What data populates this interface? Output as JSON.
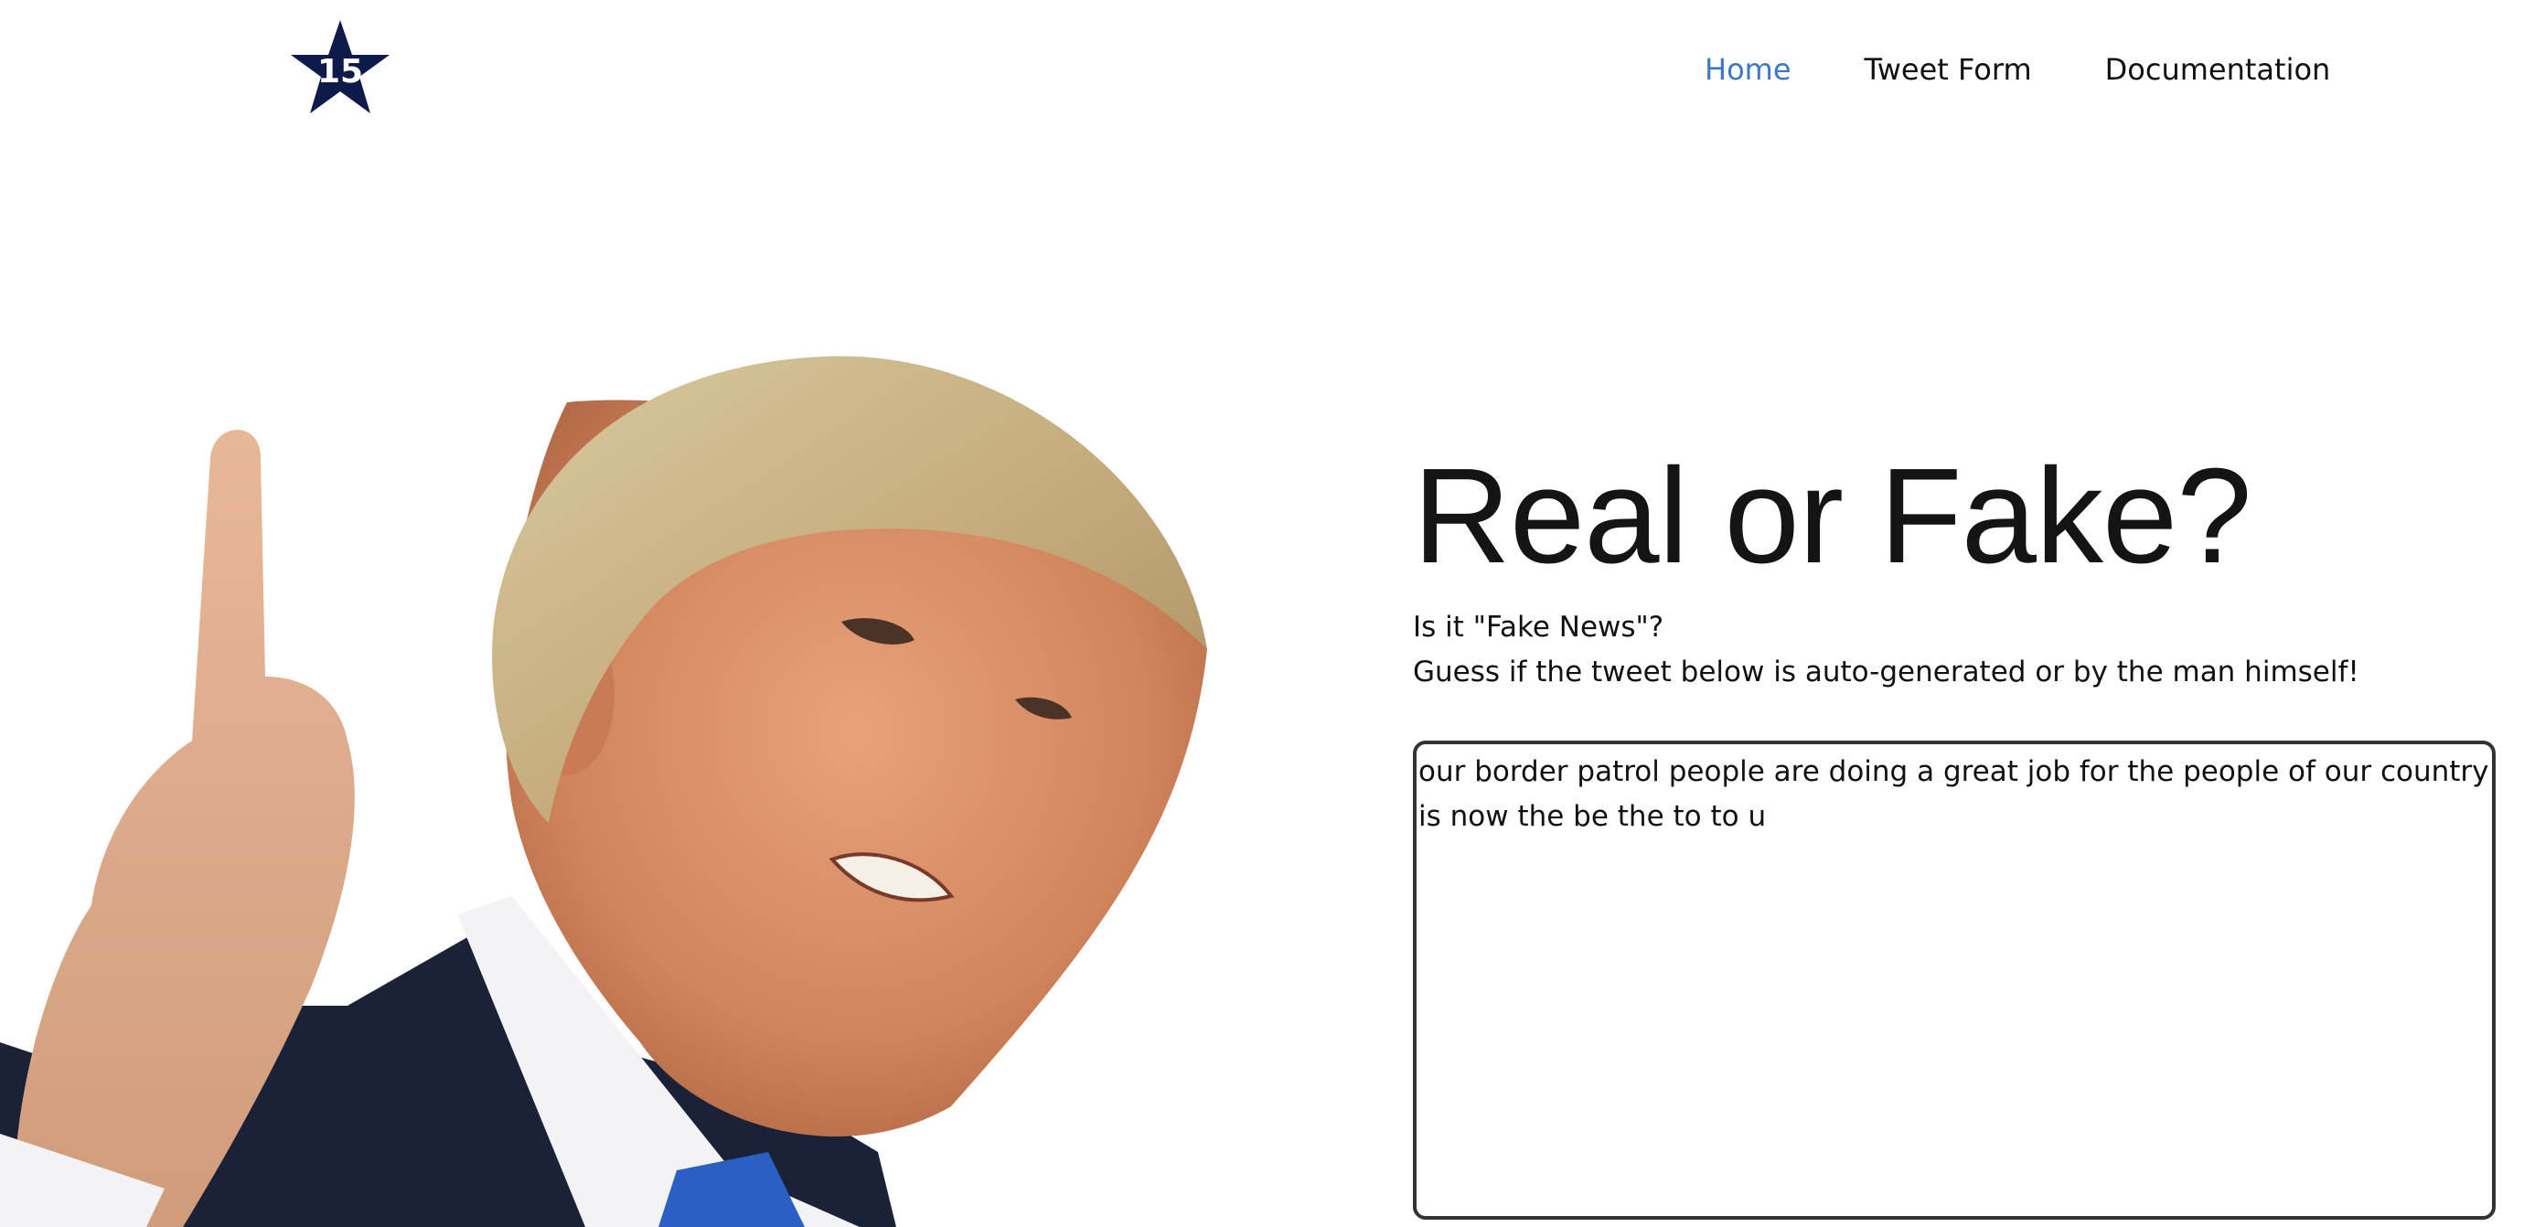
{
  "header": {
    "logo_text": "15",
    "nav": [
      {
        "label": "Home",
        "active": true
      },
      {
        "label": "Tweet Form",
        "active": false
      },
      {
        "label": "Documentation",
        "active": false
      }
    ]
  },
  "main": {
    "title": "Real or Fake?",
    "subtitle_line1": "Is it \"Fake News\"?",
    "subtitle_line2": "Guess if the tweet below is auto-generated or by the man himself!",
    "tweet_text": "our border patrol people are doing a great job for the people of our country is now the be the to to u"
  },
  "colors": {
    "accent": "#3d78c4",
    "logo_star": "#0e1a4a",
    "text": "#111111",
    "border": "#333333"
  },
  "icons": {
    "logo": "star-logo-icon"
  }
}
